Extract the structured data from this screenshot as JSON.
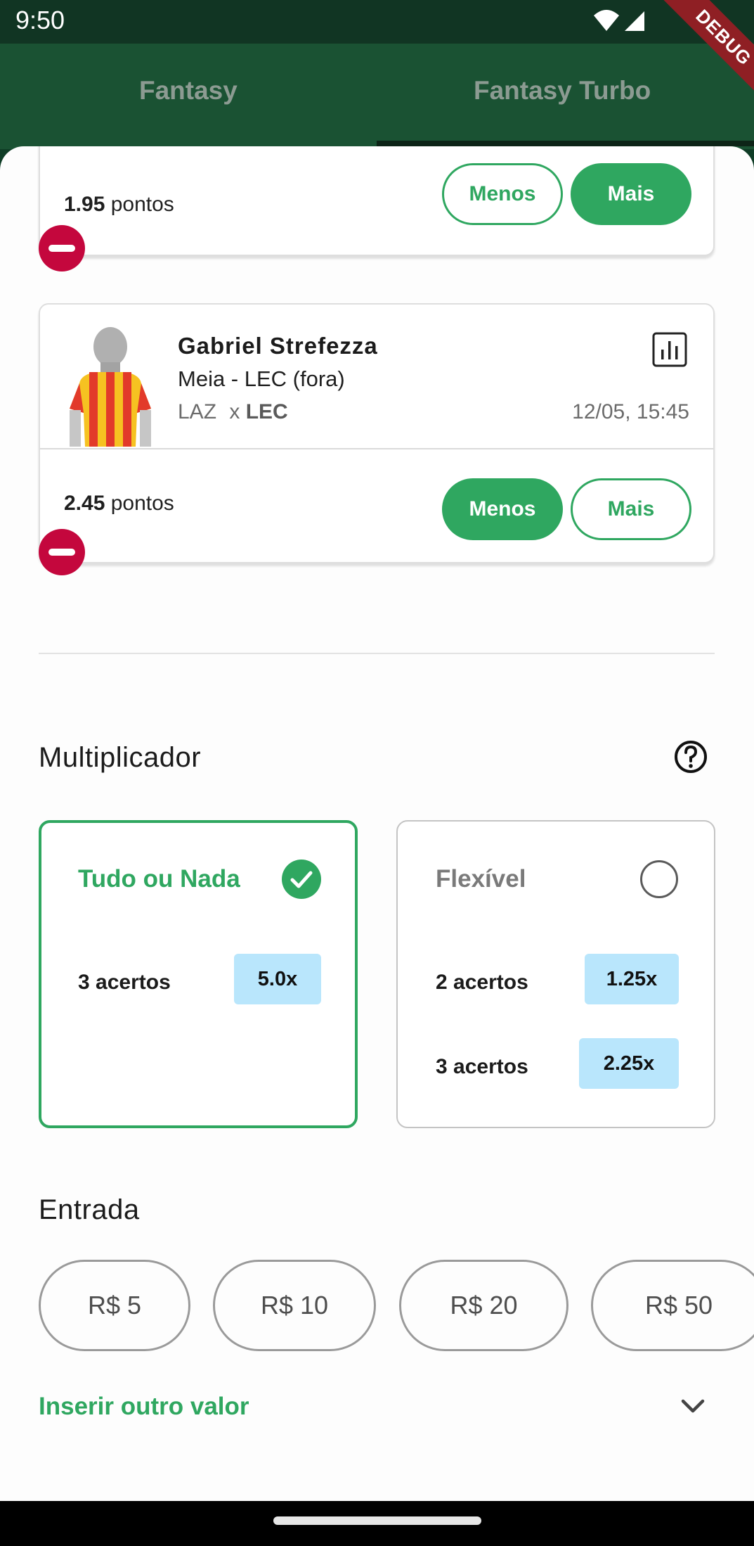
{
  "status": {
    "time": "9:50",
    "debug": "DEBUG"
  },
  "tabs": [
    {
      "label": "Fantasy"
    },
    {
      "label": "Fantasy Turbo"
    }
  ],
  "picks": [
    {
      "points": "1.95",
      "points_unit": "pontos",
      "less_label": "Menos",
      "more_label": "Mais",
      "selected": "Mais"
    },
    {
      "player_name": "Gabriel Strefezza",
      "position_line": "Meia - LEC  (fora)",
      "home": "LAZ",
      "vs": "x",
      "away": "LEC",
      "datetime": "12/05, 15:45",
      "points": "2.45",
      "points_unit": "pontos",
      "less_label": "Menos",
      "more_label": "Mais",
      "selected": "Menos"
    }
  ],
  "multiplier": {
    "title": "Multiplicador",
    "modes": [
      {
        "name": "Tudo ou Nada",
        "selected": true,
        "rows": [
          {
            "hits": "3 acertos",
            "mult": "5.0x"
          }
        ]
      },
      {
        "name": "Flexível",
        "selected": false,
        "rows": [
          {
            "hits": "2 acertos",
            "mult": "1.25x"
          },
          {
            "hits": "3 acertos",
            "mult": "2.25x"
          }
        ]
      }
    ]
  },
  "entry": {
    "title": "Entrada",
    "amounts": [
      "R$ 5",
      "R$ 10",
      "R$ 20",
      "R$ 50"
    ],
    "custom_label": "Inserir outro valor"
  },
  "colors": {
    "brand_green": "#2fa760",
    "remove_red": "#c4073d",
    "badge_blue": "#b9e6fc"
  }
}
